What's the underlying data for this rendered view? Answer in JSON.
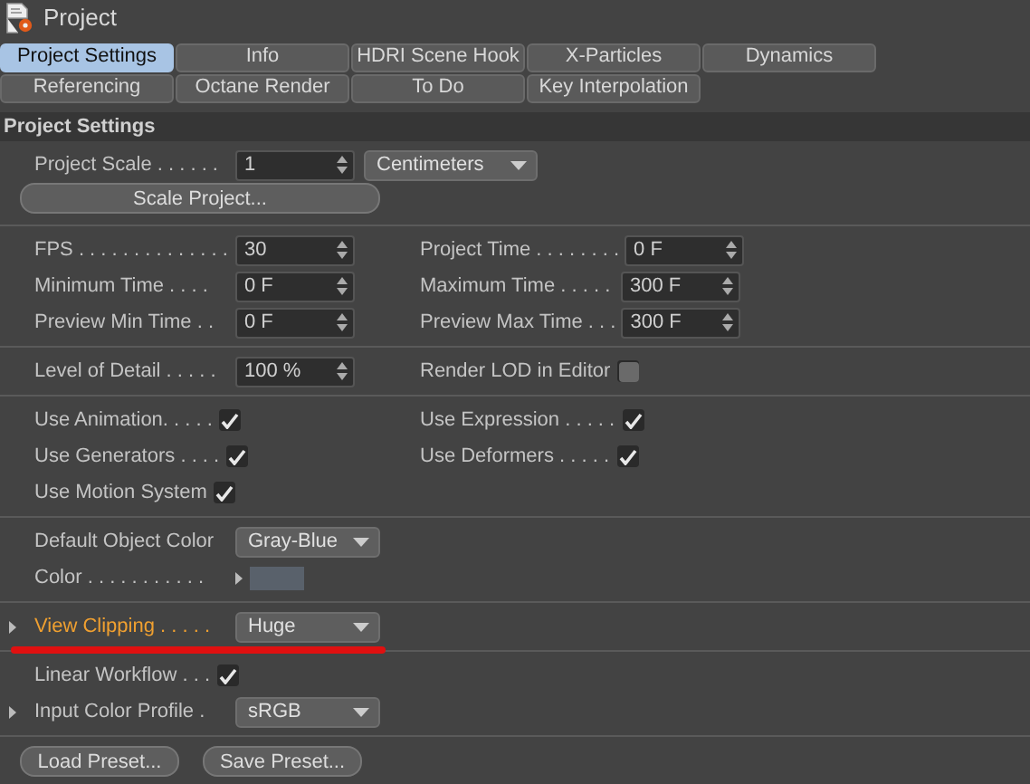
{
  "window": {
    "title": "Project"
  },
  "tab_rows": [
    {
      "tabs": [
        {
          "label": "Project Settings",
          "selected": true
        },
        {
          "label": "Info",
          "selected": false
        },
        {
          "label": "HDRI Scene Hook",
          "selected": false
        },
        {
          "label": "X-Particles",
          "selected": false
        },
        {
          "label": "Dynamics",
          "selected": false
        }
      ]
    },
    {
      "tabs": [
        {
          "label": "Referencing",
          "selected": false
        },
        {
          "label": "Octane Render",
          "selected": false
        },
        {
          "label": "To Do",
          "selected": false
        },
        {
          "label": "Key Interpolation",
          "selected": false
        }
      ]
    }
  ],
  "section": {
    "title": "Project Settings"
  },
  "groups": [
    {
      "rows": [
        {
          "cells": [
            {
              "kind": "scale",
              "label": "Project Scale . . . . . .",
              "value": "1",
              "unit": "Centimeters"
            }
          ]
        },
        {
          "cells": [
            {
              "kind": "wide-button",
              "label": "Scale Project..."
            }
          ]
        }
      ]
    },
    {
      "rows": [
        {
          "cells": [
            {
              "kind": "number",
              "label": "FPS . . . . . . . . . . . . . .",
              "value": "30"
            },
            {
              "kind": "number",
              "label": "Project Time . . . . . . . .",
              "value": "0 F"
            }
          ]
        },
        {
          "cells": [
            {
              "kind": "number",
              "label": "Minimum Time . . . .",
              "value": "0 F"
            },
            {
              "kind": "number",
              "label": "Maximum Time . . . . .",
              "value": "300 F"
            }
          ]
        },
        {
          "cells": [
            {
              "kind": "number",
              "label": "Preview Min Time . .",
              "value": "0 F"
            },
            {
              "kind": "number",
              "label": "Preview Max Time . . .",
              "value": "300 F"
            }
          ]
        }
      ]
    },
    {
      "rows": [
        {
          "cells": [
            {
              "kind": "number",
              "label": "Level of Detail . . . . .",
              "value": "100 %"
            },
            {
              "kind": "check",
              "label": "Render LOD in Editor",
              "checked": false
            }
          ]
        }
      ]
    },
    {
      "rows": [
        {
          "cells": [
            {
              "kind": "check",
              "label": "Use Animation. . . . .",
              "checked": true
            },
            {
              "kind": "check",
              "label": "Use Expression . . . . .",
              "checked": true
            }
          ]
        },
        {
          "cells": [
            {
              "kind": "check",
              "label": "Use Generators . . . .",
              "checked": true
            },
            {
              "kind": "check",
              "label": "Use Deformers . . . . .",
              "checked": true
            }
          ]
        },
        {
          "cells": [
            {
              "kind": "check",
              "label": "Use Motion System",
              "checked": true
            }
          ]
        }
      ]
    },
    {
      "rows": [
        {
          "cells": [
            {
              "kind": "dropdown",
              "label": "Default Object Color",
              "value": "Gray-Blue"
            }
          ]
        },
        {
          "cells": [
            {
              "kind": "color",
              "label": "Color . . . . . . . . . . .",
              "color": "#59616b"
            }
          ]
        }
      ]
    },
    {
      "rows": [
        {
          "cells": [
            {
              "kind": "dropdown",
              "label": "View Clipping . . . . .",
              "value": "Huge",
              "expandable": true,
              "highlighted": true,
              "underlined": true
            }
          ]
        }
      ]
    },
    {
      "rows": [
        {
          "cells": [
            {
              "kind": "check",
              "label": "Linear Workflow . . .",
              "checked": true
            }
          ]
        },
        {
          "cells": [
            {
              "kind": "dropdown",
              "label": "Input Color Profile .",
              "value": "sRGB",
              "expandable": true
            }
          ]
        }
      ]
    },
    {
      "rows": [
        {
          "cells": [
            {
              "kind": "button",
              "label": "Load Preset..."
            },
            {
              "kind": "button",
              "label": "Save Preset..."
            }
          ]
        }
      ]
    }
  ]
}
